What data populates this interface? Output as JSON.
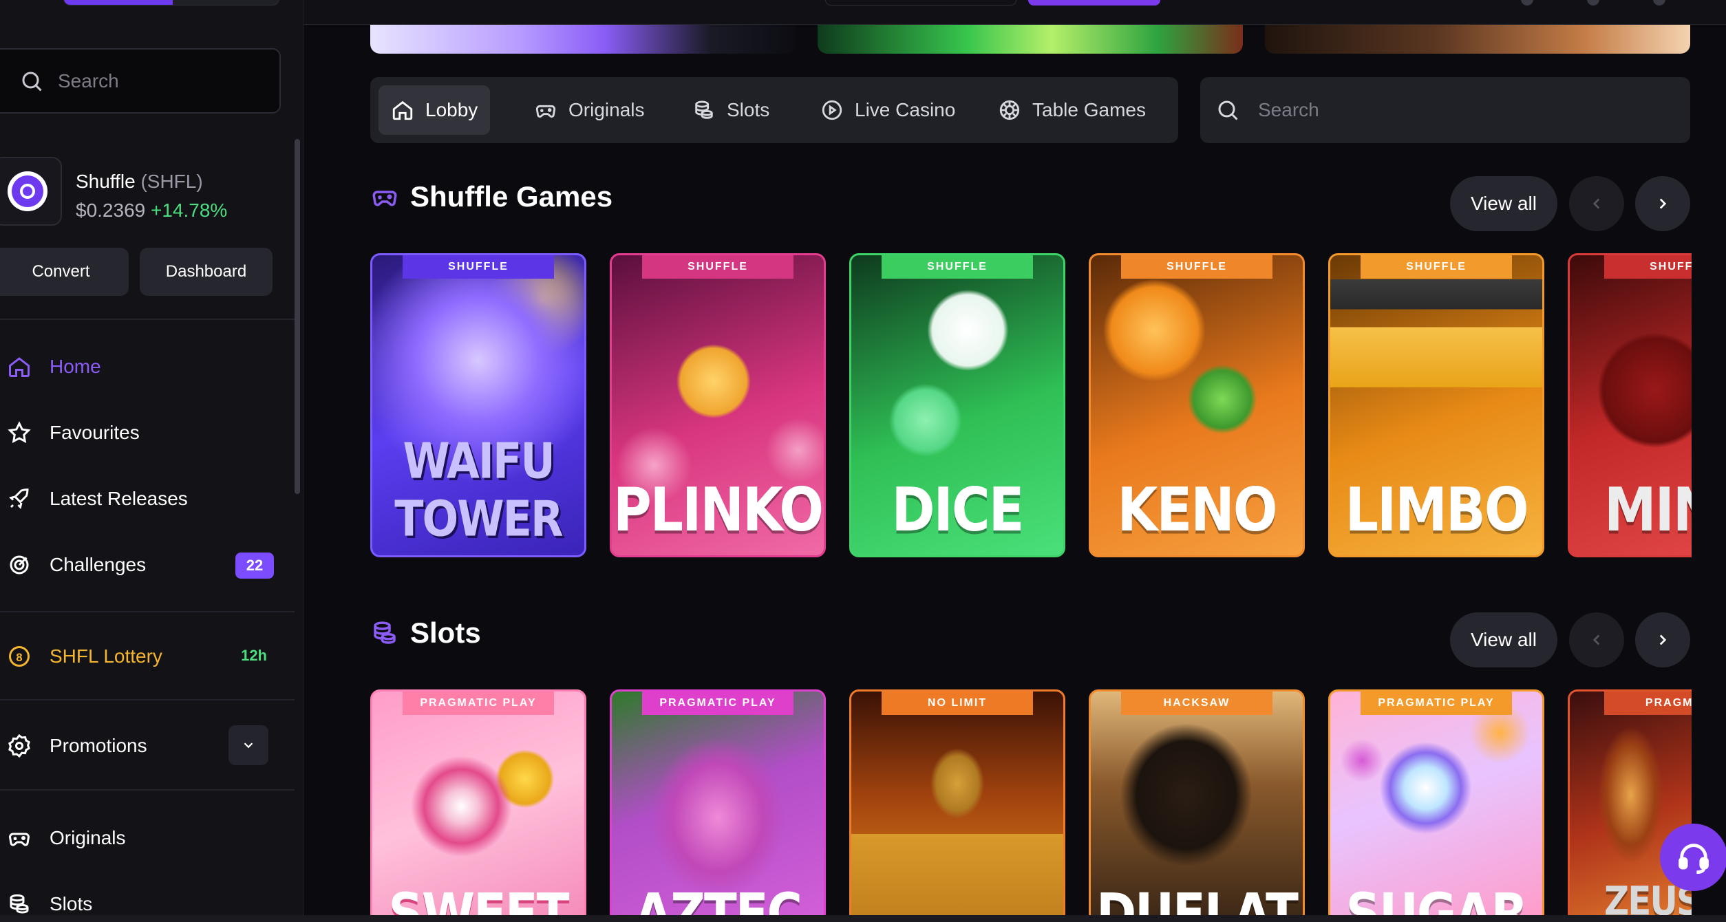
{
  "sidebar": {
    "search_placeholder": "Search",
    "token": {
      "name": "Shuffle",
      "symbol": "(SHFL)",
      "price": "$0.2369",
      "change": "+14.78%"
    },
    "buttons": {
      "convert": "Convert",
      "dashboard": "Dashboard"
    },
    "nav": [
      {
        "label": "Home",
        "icon": "home-icon",
        "active": true
      },
      {
        "label": "Favourites",
        "icon": "star-icon"
      },
      {
        "label": "Latest Releases",
        "icon": "rocket-icon"
      },
      {
        "label": "Challenges",
        "icon": "target-icon",
        "badge": "22"
      }
    ],
    "lottery": {
      "label": "SHFL Lottery",
      "time": "12h"
    },
    "promotions": {
      "label": "Promotions"
    },
    "bottom_nav": [
      {
        "label": "Originals",
        "icon": "gamepad-icon"
      },
      {
        "label": "Slots",
        "icon": "coins-icon"
      }
    ]
  },
  "tabs": [
    {
      "label": "Lobby",
      "icon": "home-icon",
      "active": true
    },
    {
      "label": "Originals",
      "icon": "gamepad-icon"
    },
    {
      "label": "Slots",
      "icon": "coins-icon"
    },
    {
      "label": "Live Casino",
      "icon": "play-circle-icon"
    },
    {
      "label": "Table Games",
      "icon": "chip-icon"
    }
  ],
  "main_search_placeholder": "Search",
  "sections": {
    "shuffle_games": {
      "title": "Shuffle Games",
      "view_all": "View all",
      "cards": [
        {
          "provider": "SHUFFLE",
          "title": "WAIFU TOWER",
          "accent": "#7c5cff"
        },
        {
          "provider": "SHUFFLE",
          "title": "PLINKO",
          "accent": "#e23d8f"
        },
        {
          "provider": "SHUFFLE",
          "title": "DICE",
          "accent": "#3fd46a"
        },
        {
          "provider": "SHUFFLE",
          "title": "KENO",
          "accent": "#f28a2e"
        },
        {
          "provider": "SHUFFLE",
          "title": "LIMBO",
          "accent": "#f49a2a"
        },
        {
          "provider": "SHUFFLE",
          "title": "MIN",
          "accent": "#d93b3b"
        }
      ]
    },
    "slots": {
      "title": "Slots",
      "view_all": "View all",
      "cards": [
        {
          "provider": "PRAGMATIC PLAY",
          "title": "SWEET",
          "accent": "#ff7fb4"
        },
        {
          "provider": "PRAGMATIC PLAY",
          "title": "AZTEC",
          "accent": "#e13fd0"
        },
        {
          "provider": "NO LIMIT",
          "title": "",
          "accent": "#f07b2a"
        },
        {
          "provider": "HACKSAW",
          "title": "DUELAT",
          "accent": "#f28a2e"
        },
        {
          "provider": "PRAGMATIC PLAY",
          "title": "SUGAR",
          "accent": "#f49a2a"
        },
        {
          "provider": "PRAGMATI",
          "title": "ZEUS",
          "accent": "#e0552e"
        }
      ]
    }
  }
}
